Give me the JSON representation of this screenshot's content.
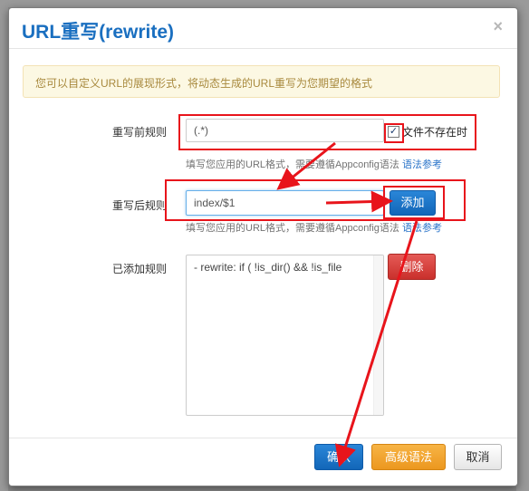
{
  "dialog": {
    "title": "URL重写(rewrite)",
    "close_glyph": "×",
    "notice": "您可以自定义URL的展现形式，将动态生成的URL重写为您期望的格式"
  },
  "form": {
    "before": {
      "label": "重写前规则",
      "value": "(.*)",
      "checkbox_checked": true,
      "checkbox_glyph": "✓",
      "checkbox_label": "文件不存在时",
      "help": "填写您应用的URL格式，需要遵循Appconfig语法",
      "help_link": "语法参考"
    },
    "after": {
      "label": "重写后规则",
      "value": "index/$1",
      "add_button": "添加",
      "help": "填写您应用的URL格式，需要遵循Appconfig语法",
      "help_link": "语法参考"
    },
    "added": {
      "label": "已添加规则",
      "rules_text": "- rewrite: if ( !is_dir() && !is_file",
      "delete_button": "删除"
    }
  },
  "footer": {
    "confirm_button": "确认",
    "advanced_button": "高级语法",
    "cancel_button": "取消"
  },
  "colors": {
    "title": "#1a6fc0",
    "primary": "#1266b8",
    "danger": "#c9302c",
    "warning": "#ec971f",
    "annotation": "#e8141b"
  }
}
